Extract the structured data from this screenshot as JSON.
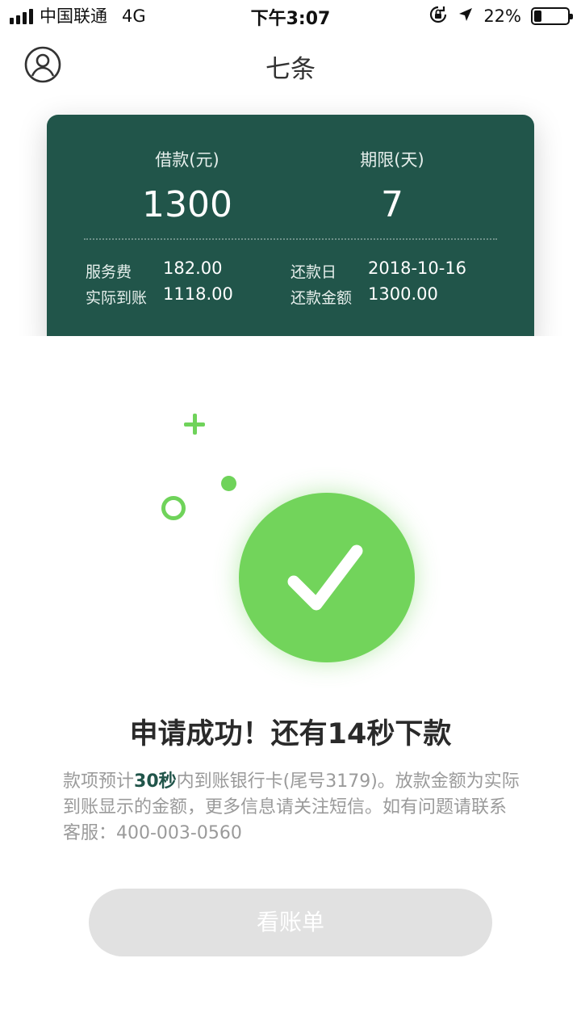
{
  "status_bar": {
    "carrier": "中国联通",
    "network": "4G",
    "time": "下午3:07",
    "battery_percent": "22%",
    "battery_level": 0.22,
    "icons": [
      "signal-icon",
      "orientation-lock-icon",
      "location-arrow-icon",
      "battery-icon"
    ]
  },
  "nav": {
    "title": "七条",
    "left_icon": "user-profile-icon"
  },
  "loan_card": {
    "amount_label": "借款(元)",
    "amount_value": "1300",
    "term_label": "期限(天)",
    "term_value": "7",
    "details": {
      "service_fee_label": "服务费",
      "service_fee_value": "182.00",
      "actual_received_label": "实际到账",
      "actual_received_value": "1118.00",
      "repay_date_label": "还款日",
      "repay_date_value": "2018-10-16",
      "repay_amount_label": "还款金额",
      "repay_amount_value": "1300.00"
    },
    "background_color": "#21554a"
  },
  "success": {
    "icon": "checkmark-circle-icon",
    "accent_color": "#72d45b",
    "headline": "申请成功！还有14秒下款",
    "description_prefix": "款项预计",
    "description_highlight": "30秒",
    "description_suffix": "内到账银行卡(尾号3179)。放款金额为实际到账显示的金额，更多信息请关注短信。如有问题请联系客服：400-003-0560"
  },
  "actions": {
    "view_bill_label": "看账单"
  }
}
